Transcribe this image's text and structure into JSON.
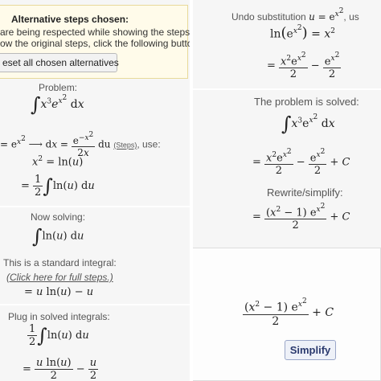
{
  "left": {
    "alt_title": "Alternative steps chosen:",
    "alt_line1": "are being respected while showing the steps.",
    "alt_line2": "ow the original steps, click the following butto",
    "reset_button": "eset all chosen alternatives",
    "problem_label": "Problem:",
    "substitution_rest": "du",
    "steps_link": "(Steps)",
    "use_label": ", use:",
    "now_solving_label": "Now solving:",
    "standard_integral_label": "This is a standard integral:",
    "full_steps_link": "(Click here for full steps.)",
    "plug_in_label": "Plug in solved integrals:"
  },
  "right": {
    "undo_label": "Undo substitution",
    "undo_suffix": ", us",
    "solved_label": "The problem is solved:",
    "rewrite_label": "Rewrite/simplify:",
    "simplify_button": "Simplify"
  },
  "colors": {
    "highlight_bg": "#fffbea",
    "panel_bg": "#f6f6f6",
    "link": "#555555"
  }
}
